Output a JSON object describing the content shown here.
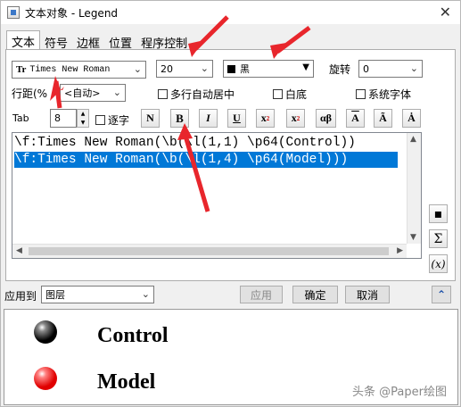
{
  "window": {
    "title": "文本对象 - Legend",
    "close_glyph": "✕"
  },
  "tabs": [
    {
      "label": "文本",
      "active": true
    },
    {
      "label": "符号",
      "active": false
    },
    {
      "label": "边框",
      "active": false
    },
    {
      "label": "位置",
      "active": false
    },
    {
      "label": "程序控制",
      "active": false
    }
  ],
  "font": {
    "icon": "Tr",
    "value": "Times New Roman"
  },
  "size": {
    "value": "20"
  },
  "color": {
    "swatch": "#000000",
    "value": "黑"
  },
  "rotation": {
    "label": "旋转",
    "value": "0"
  },
  "spacing": {
    "label": "行距(%",
    "value": "<自动>"
  },
  "checkboxes": {
    "multiline_center": "多行自动居中",
    "white_bg": "白底",
    "system_font": "系统字体",
    "char_by_char": "逐字"
  },
  "tab": {
    "label": "Tab",
    "value": "8"
  },
  "format_buttons": {
    "normal": "N",
    "bold": "B",
    "italic": "I",
    "underline": "U",
    "superscript": "x",
    "sup_mark": "2",
    "subscript": "x",
    "sub_mark": "2",
    "greek": "αβ",
    "overline": "A",
    "tilde": "Ã",
    "dot": "Ȧ"
  },
  "editor": {
    "lines": [
      "\\f:Times New Roman(\\b(\\l(1,1) \\p64(Control))",
      "\\f:Times New Roman(\\b(\\l(1,4) \\p64(Model)))"
    ]
  },
  "side_buttons": {
    "insert": "▪",
    "sigma": "Σ",
    "formula": "(x)"
  },
  "bottom": {
    "apply_to_label": "应用到",
    "apply_to_value": "图层",
    "apply": "应用",
    "ok": "确定",
    "cancel": "取消",
    "collapse": "⌃"
  },
  "preview": {
    "items": [
      {
        "label": "Control",
        "color": "#000000"
      },
      {
        "label": "Model",
        "color": "#ff0000"
      }
    ]
  },
  "watermark": "头条 @Paper绘图"
}
